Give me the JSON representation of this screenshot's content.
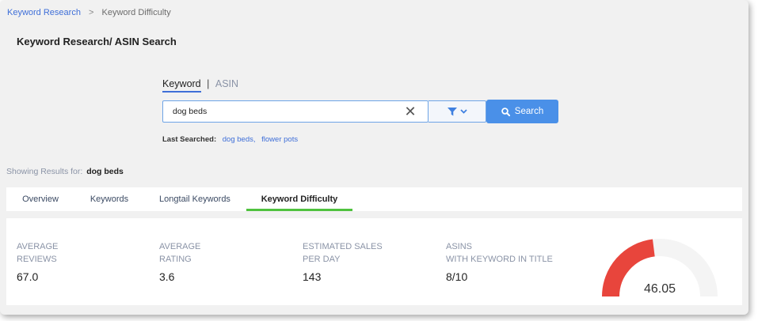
{
  "breadcrumb": {
    "root": "Keyword Research",
    "separator": ">",
    "current": "Keyword Difficulty"
  },
  "page_title": "Keyword Research/ ASIN Search",
  "mode_tabs": {
    "keyword": "Keyword",
    "separator": "|",
    "asin": "ASIN"
  },
  "search": {
    "value": "dog beds",
    "clear_glyph": "✕",
    "button_label": "Search"
  },
  "last_searched": {
    "label": "Last Searched:",
    "items": [
      "dog beds,",
      "flower pots"
    ]
  },
  "showing": {
    "label": "Showing Results for:",
    "term": "dog beds"
  },
  "tabs": [
    {
      "label": "Overview"
    },
    {
      "label": "Keywords"
    },
    {
      "label": "Longtail Keywords"
    },
    {
      "label": "Keyword Difficulty"
    }
  ],
  "stats": [
    {
      "line1": "AVERAGE",
      "line2": "REVIEWS",
      "value": "67.0"
    },
    {
      "line1": "AVERAGE",
      "line2": "RATING",
      "value": "3.6"
    },
    {
      "line1": "ESTIMATED SALES",
      "line2": "PER DAY",
      "value": "143"
    },
    {
      "line1": "ASINS",
      "line2": "WITH KEYWORD IN TITLE",
      "value": "8/10"
    }
  ],
  "gauge": {
    "value": "46.05",
    "fraction": 0.4605,
    "fill_color": "#e8453c",
    "track_color": "#f4f4f4"
  },
  "colors": {
    "accent": "#3f6fd8",
    "button": "#4a90e8",
    "active_tab_underline": "#4fc23e"
  }
}
